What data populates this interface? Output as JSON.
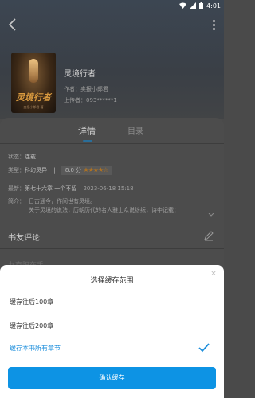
{
  "status_bar": {
    "time": "4:01"
  },
  "book": {
    "cover_title": "灵境行者",
    "cover_subtitle": "卖报小郎君 著",
    "title": "灵境行者",
    "author_line": "作者：卖报小郎君",
    "uploader_line": "上传者：093******1"
  },
  "tabs": [
    {
      "label": "详情"
    },
    {
      "label": "目录"
    }
  ],
  "details": {
    "status_label": "状态：",
    "status_value": "连载",
    "type_label": "类型：",
    "type_value": "科幻灵异",
    "type_sep": "|",
    "score_text": "8.0 分",
    "stars": "★★★★☆",
    "latest_label": "最新：",
    "latest_value": "第七十六章 一个不留",
    "latest_date": "2023-06-18 15:18",
    "intro_label": "简介：",
    "intro_text": "日古通今，作间世有灵境。\n关于灵境的说法，历朝历代的名人雅士众说纷纭，诗中记载："
  },
  "comments": {
    "header": "书友评论",
    "ghost_user": "九京阳在手"
  },
  "modal": {
    "title": "选择缓存范围",
    "close": "×",
    "options": [
      {
        "label": "缓存往后100章",
        "selected": false
      },
      {
        "label": "缓存往后200章",
        "selected": false
      },
      {
        "label": "缓存本书所有章节",
        "selected": true
      }
    ],
    "confirm_label": "确认缓存",
    "accent": "#0d93e4"
  }
}
